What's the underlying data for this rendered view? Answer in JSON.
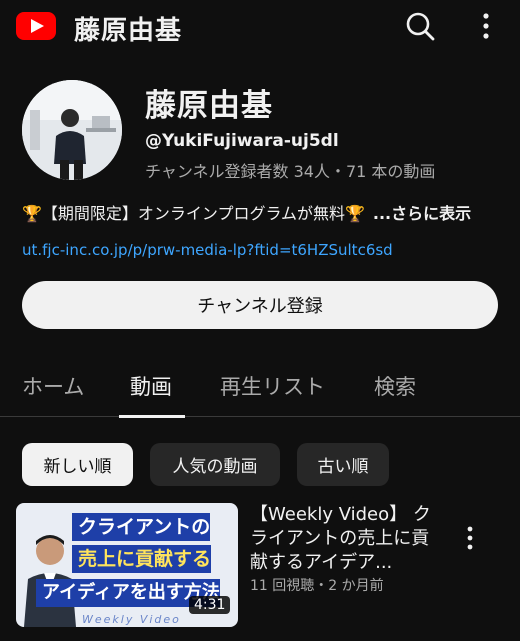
{
  "header": {
    "title": "藤原由基",
    "logo_icon": "youtube-logo-icon",
    "search_icon": "search-icon",
    "menu_icon": "more-vert-icon",
    "brand_color": "#ff0000"
  },
  "channel": {
    "name": "藤原由基",
    "handle": "@YukiFujiwara-uj5dl",
    "stats": "チャンネル登録者数 34人・71 本の動画",
    "description": "🏆【期間限定】オンラインプログラムが無料🏆",
    "more_label": "...さらに表示",
    "link": "ut.fjc-inc.co.jp/p/prw-media-lp?ftid=t6HZSultc6sd",
    "subscribe_label": "チャンネル登録"
  },
  "tabs": [
    {
      "label": "ホーム",
      "active": false
    },
    {
      "label": "動画",
      "active": true
    },
    {
      "label": "再生リスト",
      "active": false
    },
    {
      "label": "検索",
      "active": false
    }
  ],
  "chips": [
    {
      "label": "新しい順",
      "active": true
    },
    {
      "label": "人気の動画",
      "active": false
    },
    {
      "label": "古い順",
      "active": false
    }
  ],
  "videos": [
    {
      "title": "【Weekly Video】 クライアントの売上に貢献するアイデア...",
      "meta": "11 回視聴・2 か月前",
      "duration": "4:31",
      "thumbnail_text": {
        "line1": "クライアントの",
        "line2": "売上に貢献する",
        "line3": "アイディアを出す方法",
        "watermark": "Weekly Video"
      }
    }
  ]
}
